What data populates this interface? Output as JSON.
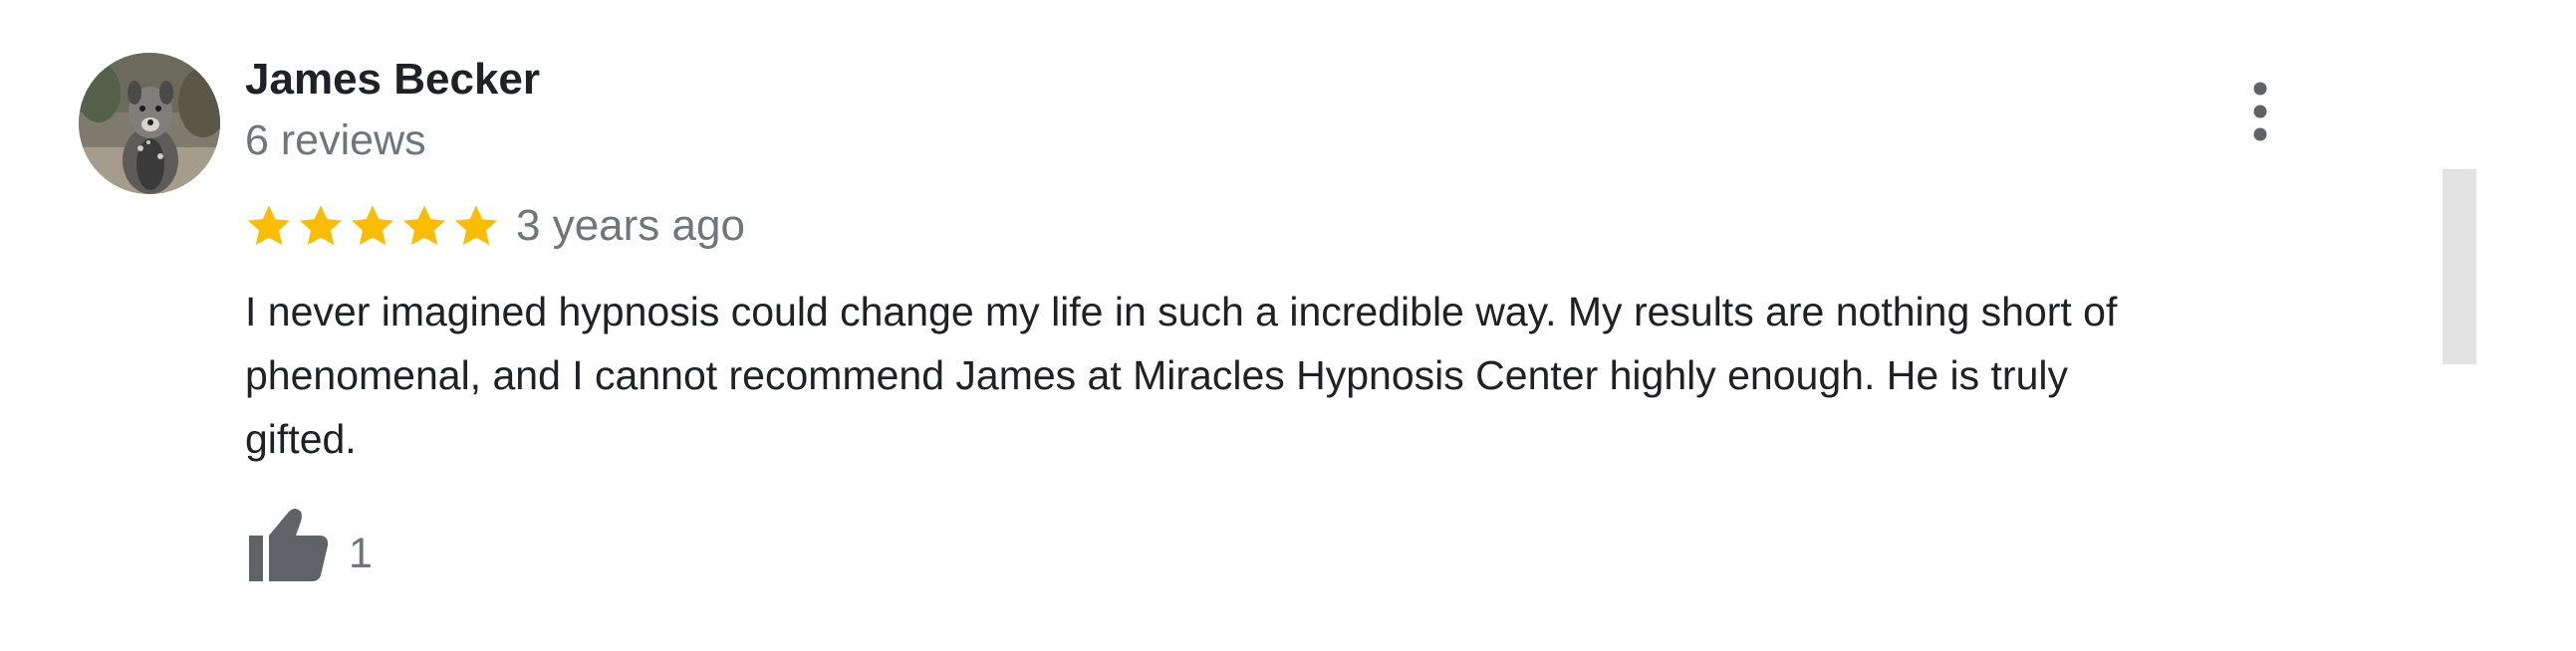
{
  "review": {
    "author_name": "James Becker",
    "review_count": "6 reviews",
    "rating": 5,
    "rating_max": 5,
    "date": "3 years ago",
    "text_lines": [
      "I never imagined hypnosis could change my life in such a incredible way. My results are nothing short of",
      "phenomenal, and I cannot recommend James at Miracles Hypnosis Center highly enough. He is truly",
      "gifted."
    ],
    "like_count": "1"
  },
  "icons": {
    "avatar": "dog-photo-avatar",
    "more": "more-vert-icon",
    "star": "star-icon",
    "like": "thumbs-up-icon"
  },
  "colors": {
    "star": "#fbbc04",
    "secondary_text": "#70757a",
    "primary_text": "#202124",
    "icon_gray": "#5f6368",
    "scrollbar": "#e3e3e3"
  }
}
